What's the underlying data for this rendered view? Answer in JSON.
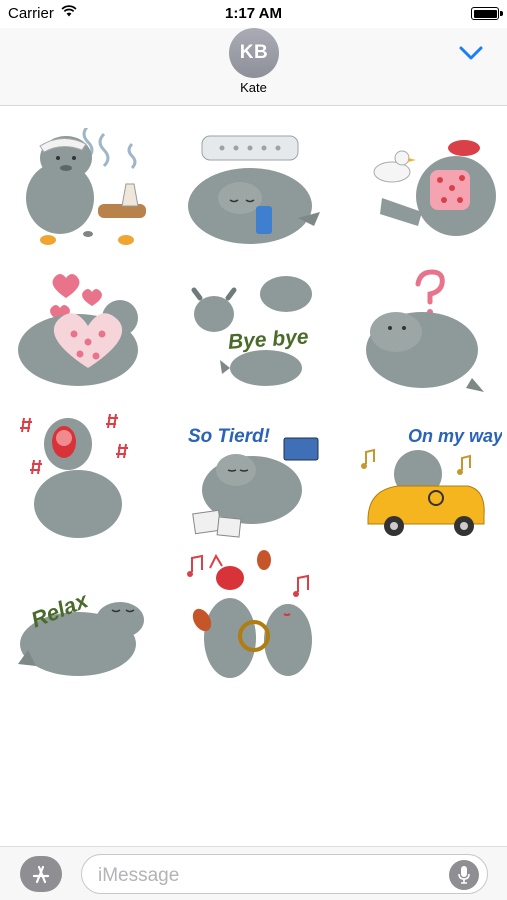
{
  "status_bar": {
    "carrier": "Carrier",
    "time": "1:17 AM"
  },
  "contact": {
    "initials": "KB",
    "name": "Kate"
  },
  "stickers": [
    {
      "id": "hot-spring",
      "caption": ""
    },
    {
      "id": "sleeping-with-phone",
      "caption": ""
    },
    {
      "id": "bird-and-pillow",
      "caption": ""
    },
    {
      "id": "hearts-pillow",
      "caption": ""
    },
    {
      "id": "bye-bye",
      "caption": "Bye bye"
    },
    {
      "id": "question",
      "caption": ""
    },
    {
      "id": "yawning",
      "caption": ""
    },
    {
      "id": "so-tired",
      "caption": "So Tierd!"
    },
    {
      "id": "on-my-way",
      "caption": "On my way"
    },
    {
      "id": "relax",
      "caption": "Relax"
    },
    {
      "id": "singing-maracas",
      "caption": ""
    }
  ],
  "input": {
    "placeholder": "iMessage"
  },
  "colors": {
    "accent": "#1a7ef7",
    "seal_body": "#8e9a99",
    "seal_shadow": "#6f7b7a",
    "caption_blue": "#2a63b8",
    "caption_green": "#4a6b2a",
    "heart_pink": "#e8738a",
    "car_yellow": "#f4b51f"
  },
  "icons": {
    "wifi": "wifi-icon",
    "battery": "battery-icon",
    "chevron": "chevron-down-icon",
    "app_store": "app-store-icon",
    "mic": "microphone-icon"
  }
}
